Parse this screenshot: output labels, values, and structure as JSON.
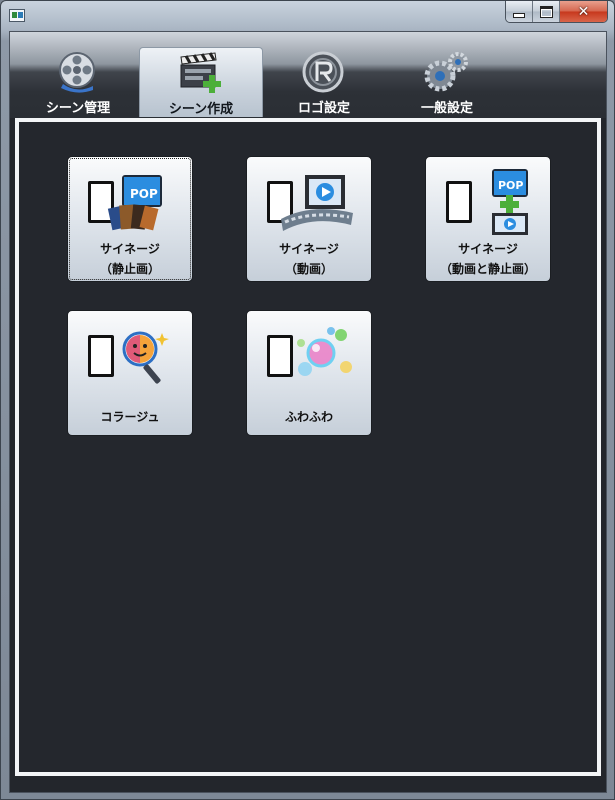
{
  "window": {
    "controls": {
      "minimize": "minimize-icon",
      "maximize": "maximize-icon",
      "close": "close-icon"
    }
  },
  "tabs": [
    {
      "label": "シーン管理",
      "icon": "film-reel-icon",
      "active": false
    },
    {
      "label": "シーン作成",
      "icon": "clapperboard-add-icon",
      "active": true
    },
    {
      "label": "ロゴ設定",
      "icon": "logo-r-icon",
      "active": false
    },
    {
      "label": "一般設定",
      "icon": "gears-icon",
      "active": false
    }
  ],
  "tiles": [
    {
      "line1": "サイネージ",
      "line2": "（静止画）",
      "icon": "signage-still-icon",
      "selected": true
    },
    {
      "line1": "サイネージ",
      "line2": "（動画）",
      "icon": "signage-video-icon",
      "selected": false
    },
    {
      "line1": "サイネージ",
      "line2": "（動画と静止画）",
      "icon": "signage-video-still-icon",
      "selected": false
    },
    {
      "line1": "コラージュ",
      "icon": "collage-icon",
      "selected": false
    },
    {
      "line1": "ふわふわ",
      "icon": "bubbles-icon",
      "selected": false
    }
  ],
  "badges": {
    "pop": "POP"
  },
  "colors": {
    "accent_green": "#4caf3a",
    "pop_blue": "#2b8de0",
    "client_bg": "#24272d"
  }
}
